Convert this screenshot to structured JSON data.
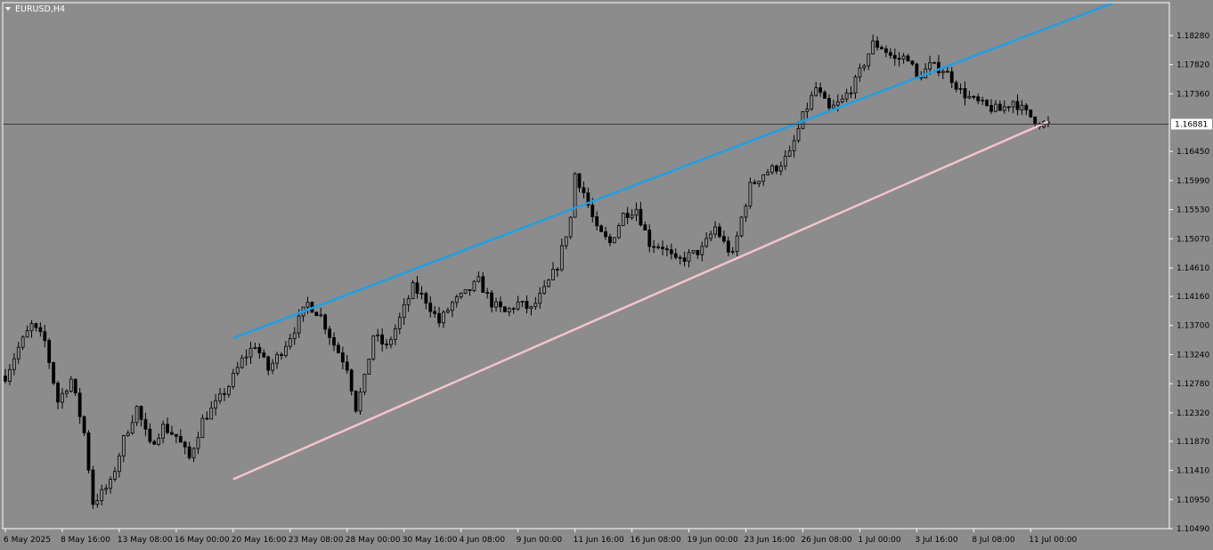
{
  "chart_data": {
    "type": "candlestick",
    "title": "EURUSD,H4",
    "colors": {
      "background": "#8c8c8c",
      "axis": "#ffffff",
      "candles": "#000000",
      "upper_channel": "#1ea0e6",
      "lower_channel": "#f5c3cd",
      "price_line": "#3a3a3a",
      "price_label_bg": "#ffffff"
    },
    "y_axis": {
      "min": 1.1049,
      "max": 1.188,
      "ticks": [
        "1.18280",
        "1.17820",
        "1.17360",
        "1.16450",
        "1.15990",
        "1.15530",
        "1.15070",
        "1.14610",
        "1.14160",
        "1.13700",
        "1.13240",
        "1.12780",
        "1.12320",
        "1.11870",
        "1.11410",
        "1.10950",
        "1.10490"
      ],
      "current_price": "1.16881"
    },
    "x_axis": {
      "labels": [
        "6 May 2025",
        "8 May 16:00",
        "13 May 08:00",
        "16 May 00:00",
        "20 May 16:00",
        "23 May 08:00",
        "28 May 00:00",
        "30 May 16:00",
        "4 Jun 08:00",
        "9 Jun 00:00",
        "11 Jun 16:00",
        "16 Jun 08:00",
        "19 Jun 00:00",
        "23 Jun 16:00",
        "26 Jun 08:00",
        "1 Jul 00:00",
        "3 Jul 16:00",
        "8 Jul 08:00",
        "11 Jul 00:00"
      ]
    },
    "keypoints": [
      [
        0,
        1.129
      ],
      [
        3,
        1.1335
      ],
      [
        6,
        1.137
      ],
      [
        9,
        1.1345
      ],
      [
        12,
        1.125
      ],
      [
        15,
        1.1285
      ],
      [
        18,
        1.12
      ],
      [
        20,
        1.109
      ],
      [
        24,
        1.112
      ],
      [
        27,
        1.119
      ],
      [
        30,
        1.124
      ],
      [
        33,
        1.118
      ],
      [
        36,
        1.121
      ],
      [
        39,
        1.1195
      ],
      [
        42,
        1.116
      ],
      [
        45,
        1.122
      ],
      [
        48,
        1.1245
      ],
      [
        51,
        1.1275
      ],
      [
        54,
        1.1315
      ],
      [
        57,
        1.134
      ],
      [
        60,
        1.13
      ],
      [
        63,
        1.133
      ],
      [
        66,
        1.1365
      ],
      [
        69,
        1.1405
      ],
      [
        72,
        1.1385
      ],
      [
        75,
        1.134
      ],
      [
        78,
        1.1305
      ],
      [
        80,
        1.124
      ],
      [
        82,
        1.1285
      ],
      [
        84,
        1.1355
      ],
      [
        87,
        1.1335
      ],
      [
        90,
        1.138
      ],
      [
        93,
        1.143
      ],
      [
        96,
        1.141
      ],
      [
        99,
        1.1375
      ],
      [
        102,
        1.1405
      ],
      [
        105,
        1.142
      ],
      [
        108,
        1.144
      ],
      [
        111,
        1.1405
      ],
      [
        114,
        1.139
      ],
      [
        117,
        1.1405
      ],
      [
        120,
        1.1395
      ],
      [
        123,
        1.1425
      ],
      [
        126,
        1.1465
      ],
      [
        129,
        1.154
      ],
      [
        130,
        1.161
      ],
      [
        132,
        1.158
      ],
      [
        135,
        1.152
      ],
      [
        138,
        1.15
      ],
      [
        141,
        1.1545
      ],
      [
        144,
        1.1555
      ],
      [
        147,
        1.15
      ],
      [
        150,
        1.1495
      ],
      [
        153,
        1.147
      ],
      [
        156,
        1.148
      ],
      [
        159,
        1.149
      ],
      [
        162,
        1.1525
      ],
      [
        164,
        1.15
      ],
      [
        166,
        1.148
      ],
      [
        168,
        1.154
      ],
      [
        170,
        1.159
      ],
      [
        173,
        1.161
      ],
      [
        176,
        1.162
      ],
      [
        179,
        1.164
      ],
      [
        182,
        1.17
      ],
      [
        185,
        1.1745
      ],
      [
        188,
        1.171
      ],
      [
        191,
        1.1725
      ],
      [
        194,
        1.1755
      ],
      [
        196,
        1.1785
      ],
      [
        198,
        1.1815
      ],
      [
        200,
        1.181
      ],
      [
        203,
        1.179
      ],
      [
        206,
        1.1795
      ],
      [
        208,
        1.176
      ],
      [
        211,
        1.178
      ],
      [
        214,
        1.1775
      ],
      [
        216,
        1.176
      ],
      [
        218,
        1.174
      ],
      [
        221,
        1.1725
      ],
      [
        224,
        1.1715
      ],
      [
        227,
        1.171
      ],
      [
        230,
        1.1725
      ],
      [
        233,
        1.1705
      ],
      [
        236,
        1.169
      ],
      [
        238,
        1.1688
      ]
    ],
    "candle_count": 239,
    "upper_channel": {
      "start": [
        52,
        1.135
      ],
      "end": [
        253,
        1.188
      ]
    },
    "lower_channel": {
      "start": [
        52,
        1.1127
      ],
      "end": [
        238,
        1.1692
      ]
    }
  }
}
